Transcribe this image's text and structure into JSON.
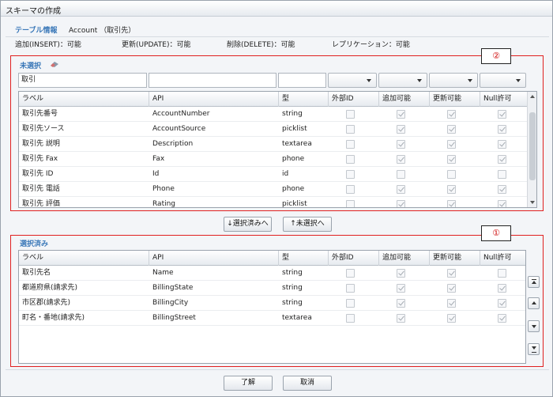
{
  "window": {
    "title": "スキーマの作成"
  },
  "table_info": {
    "label": "テーブル情報",
    "value": "Account （取引先）",
    "permissions": [
      "追加(INSERT)：可能",
      "更新(UPDATE)：可能",
      "削除(DELETE)：可能",
      "レプリケーション：可能"
    ]
  },
  "markers": {
    "unselected": "②",
    "selected": "①"
  },
  "unselected": {
    "title": "未選択",
    "filter_value": "取引",
    "columns": [
      "ラベル",
      "API",
      "型",
      "外部ID",
      "追加可能",
      "更新可能",
      "Null許可"
    ],
    "rows": [
      {
        "label": "取引先番号",
        "api": "AccountNumber",
        "type": "string",
        "ext": false,
        "ins": true,
        "upd": true,
        "nul": true
      },
      {
        "label": "取引先ソース",
        "api": "AccountSource",
        "type": "picklist",
        "ext": false,
        "ins": true,
        "upd": true,
        "nul": true
      },
      {
        "label": "取引先 説明",
        "api": "Description",
        "type": "textarea",
        "ext": false,
        "ins": true,
        "upd": true,
        "nul": true
      },
      {
        "label": "取引先 Fax",
        "api": "Fax",
        "type": "phone",
        "ext": false,
        "ins": true,
        "upd": true,
        "nul": true
      },
      {
        "label": "取引先 ID",
        "api": "Id",
        "type": "id",
        "ext": false,
        "ins": false,
        "upd": false,
        "nul": false
      },
      {
        "label": "取引先 電話",
        "api": "Phone",
        "type": "phone",
        "ext": false,
        "ins": true,
        "upd": true,
        "nul": true
      },
      {
        "label": "取引先 評価",
        "api": "Rating",
        "type": "picklist",
        "ext": false,
        "ins": true,
        "upd": true,
        "nul": true
      }
    ]
  },
  "transfer": {
    "to_selected": "↓選択済みへ",
    "to_unselected": "↑未選択へ"
  },
  "selected": {
    "title": "選択済み",
    "columns": [
      "ラベル",
      "API",
      "型",
      "外部ID",
      "追加可能",
      "更新可能",
      "Null許可"
    ],
    "rows": [
      {
        "label": "取引先名",
        "api": "Name",
        "type": "string",
        "ext": false,
        "ins": true,
        "upd": true,
        "nul": false
      },
      {
        "label": "都道府県(請求先)",
        "api": "BillingState",
        "type": "string",
        "ext": false,
        "ins": true,
        "upd": true,
        "nul": true
      },
      {
        "label": "市区郡(請求先)",
        "api": "BillingCity",
        "type": "string",
        "ext": false,
        "ins": true,
        "upd": true,
        "nul": true
      },
      {
        "label": "町名・番地(請求先)",
        "api": "BillingStreet",
        "type": "textarea",
        "ext": false,
        "ins": true,
        "upd": true,
        "nul": true
      }
    ]
  },
  "footer": {
    "ok": "了解",
    "cancel": "取消"
  },
  "colors": {
    "accent": "#3a78b8",
    "highlight_box": "#e02020"
  }
}
